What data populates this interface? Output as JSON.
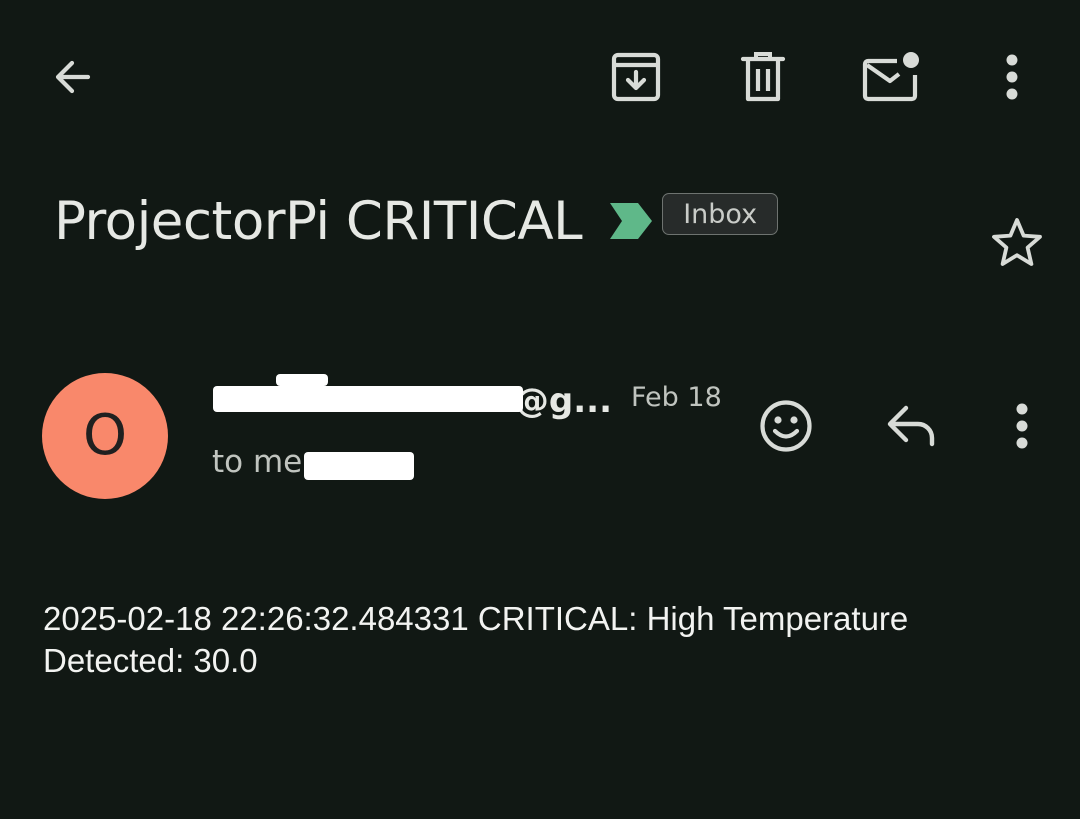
{
  "toolbar": {
    "back_icon": "arrow-left-icon",
    "archive_icon": "archive-icon",
    "delete_icon": "trash-icon",
    "mark_unread_icon": "mail-unread-icon",
    "more_icon": "more-vert-icon"
  },
  "message": {
    "subject": "ProjectorPi CRITICAL",
    "importance_icon": "importance-marker-icon",
    "label": "Inbox",
    "star_icon": "star-outline-icon"
  },
  "sender": {
    "avatar_letter": "O",
    "name": "@g...",
    "date": "Feb 18",
    "recipient": "to me",
    "react_icon": "emoji-icon",
    "reply_icon": "reply-icon",
    "more_icon": "more-vert-icon"
  },
  "body": {
    "text": "2025-02-18 22:26:32.484331 CRITICAL: High Temperature Detected: 30.0"
  },
  "colors": {
    "background": "#111814",
    "avatar": "#f9886b",
    "importance_marker": "#5fb889",
    "label_chip_bg": "#272b2a",
    "label_chip_border": "#6e7370",
    "text_primary": "#e6e8e4",
    "text_secondary": "#c0c4bf"
  }
}
